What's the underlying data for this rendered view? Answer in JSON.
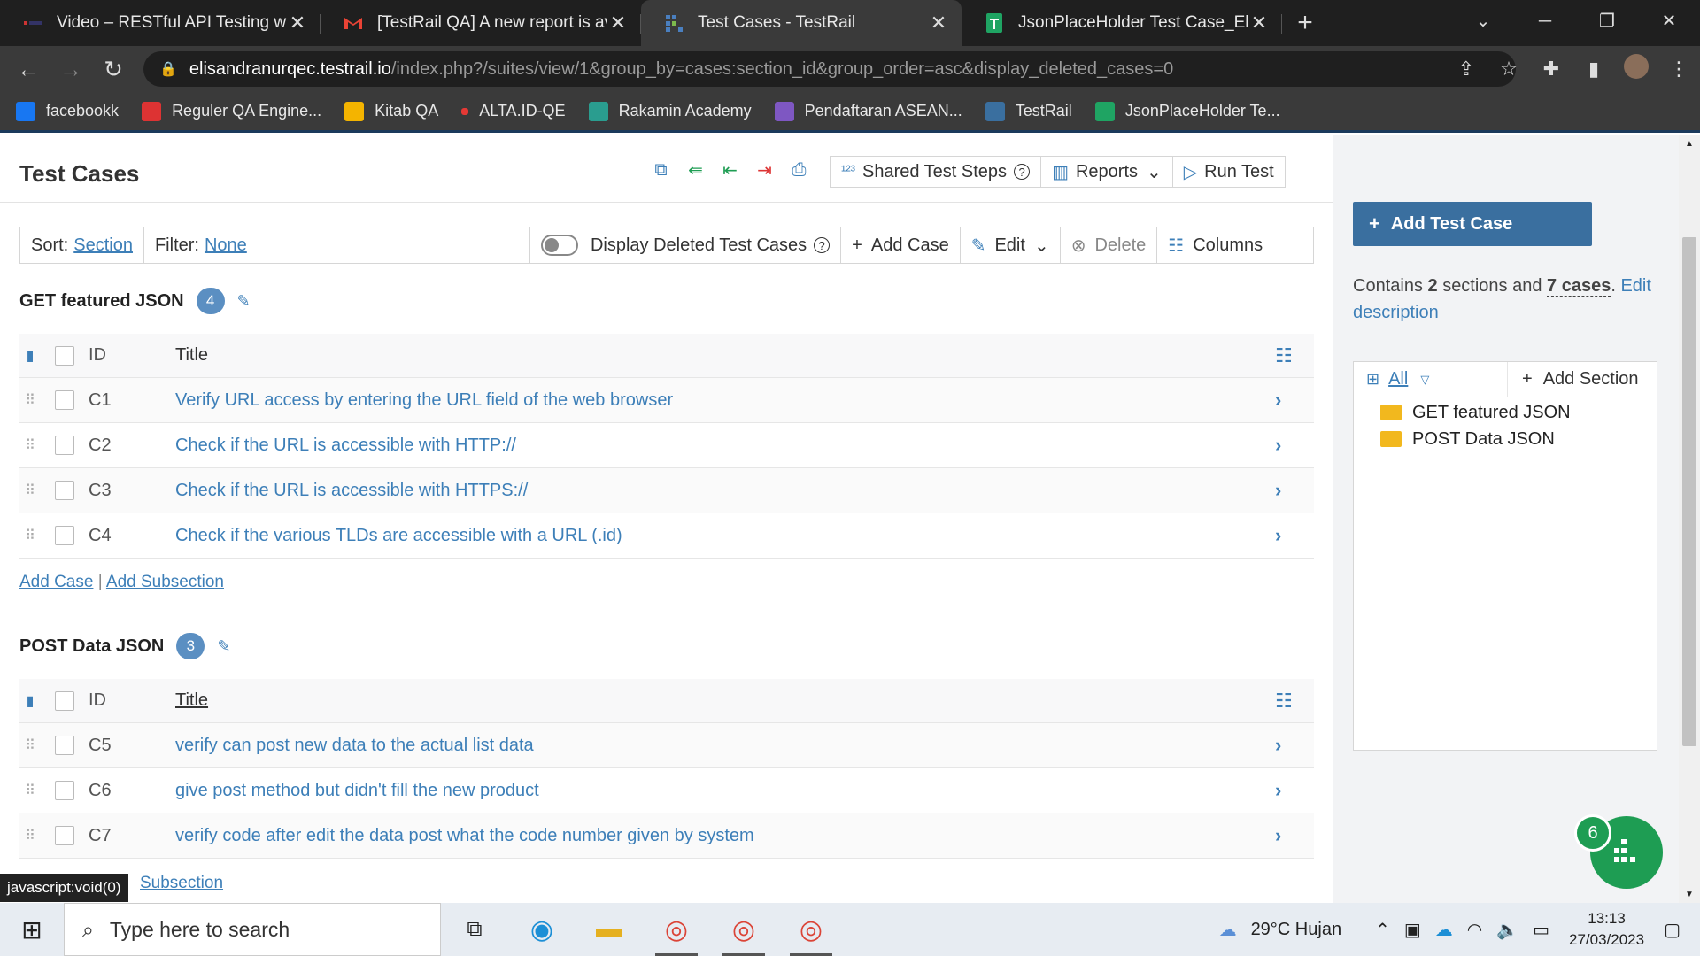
{
  "browser": {
    "tabs": [
      {
        "title": "Video – RESTful API Testing with P",
        "icon": "video-icon",
        "active": false
      },
      {
        "title": "[TestRail QA] A new report is avai",
        "icon": "gmail-icon",
        "active": false
      },
      {
        "title": "Test Cases - TestRail",
        "icon": "testrail-icon",
        "active": true
      },
      {
        "title": "JsonPlaceHolder Test Case_Elisan",
        "icon": "sheets-icon",
        "active": false
      }
    ],
    "new_tab": "+",
    "url_host": "elisandranurqec.testrail.io",
    "url_path": "/index.php?/suites/view/1&group_by=cases:section_id&group_order=asc&display_deleted_cases=0",
    "bookmarks": [
      {
        "label": "facebookk",
        "color": "#1877f2"
      },
      {
        "label": "Reguler QA Engine...",
        "color": "#d33"
      },
      {
        "label": "Kitab QA",
        "color": "#f4b400"
      },
      {
        "label": "ALTA.ID-QE",
        "color": "#e53935"
      },
      {
        "label": "Rakamin Academy",
        "color": "#2a9d8f"
      },
      {
        "label": "Pendaftaran ASEAN...",
        "color": "#7e57c2"
      },
      {
        "label": "TestRail",
        "color": "#3a6f9f"
      },
      {
        "label": "JsonPlaceHolder Te...",
        "color": "#1fa463"
      }
    ]
  },
  "page": {
    "title": "Test Cases",
    "header_buttons": {
      "shared_steps": "Shared Test Steps",
      "reports": "Reports",
      "run_test": "Run Test"
    },
    "filterbar": {
      "sort_label": "Sort:",
      "sort_value": "Section",
      "filter_label": "Filter:",
      "filter_value": "None",
      "display_deleted": "Display Deleted Test Cases",
      "add_case": "Add Case",
      "edit": "Edit",
      "delete": "Delete",
      "columns": "Columns"
    },
    "table_headers": {
      "id": "ID",
      "title": "Title"
    },
    "sections": [
      {
        "name": "GET featured JSON",
        "count": "4",
        "cases": [
          {
            "id": "C1",
            "title": "Verify URL access by entering the URL field of the web browser"
          },
          {
            "id": "C2",
            "title": "Check if the URL is accessible with HTTP://"
          },
          {
            "id": "C3",
            "title": "Check if the URL is accessible with HTTPS://"
          },
          {
            "id": "C4",
            "title": "Check if the various TLDs are accessible with a URL (.id)"
          }
        ]
      },
      {
        "name": "POST Data JSON",
        "count": "3",
        "cases": [
          {
            "id": "C5",
            "title": "verify can post new data to the actual list data"
          },
          {
            "id": "C6",
            "title": "give post method but didn't fill the new product"
          },
          {
            "id": "C7",
            "title": "verify code after edit the data post what the code number given by system"
          }
        ]
      }
    ],
    "add_case_link": "Add Case",
    "add_subsection_link": "Add Subsection",
    "partial_subsection": "Subsection",
    "status_url": "javascript:void(0)"
  },
  "sidebar": {
    "add_test_case": "Add Test Case",
    "contains_prefix": "Contains",
    "sections_count": "2",
    "sections_word": "sections and",
    "cases_count": "7 cases",
    "edit_description": "Edit description",
    "tree_filter": "All",
    "add_section": "Add Section",
    "tree": [
      "GET featured JSON",
      "POST Data JSON"
    ],
    "fab_badge": "6"
  },
  "taskbar": {
    "search_placeholder": "Type here to search",
    "weather": "29°C  Hujan",
    "time": "13:13",
    "date": "27/03/2023"
  }
}
